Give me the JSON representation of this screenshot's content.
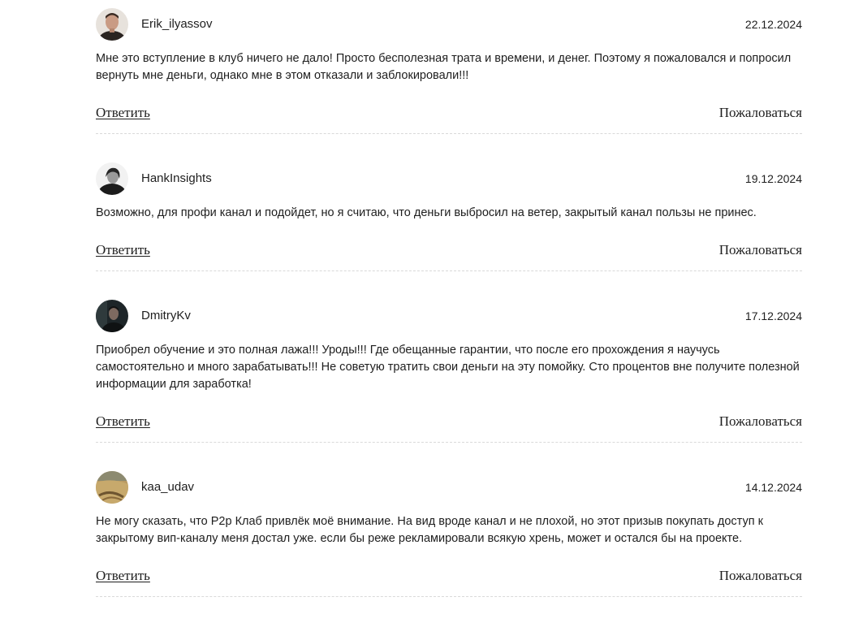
{
  "comments": [
    {
      "username": "Erik_ilyassov",
      "date": "22.12.2024",
      "text": "Мне это вступление в клуб ничего не дало! Просто бесполезная трата и времени, и денег. Поэтому я пожаловался и попросил вернуть мне деньги, однако мне в этом отказали и заблокировали!!!",
      "reply_label": "Ответить",
      "report_label": "Пожаловаться"
    },
    {
      "username": "HankInsights",
      "date": "19.12.2024",
      "text": "Возможно, для профи канал и подойдет, но я считаю, что деньги выбросил на ветер, закрытый канал пользы не принес.",
      "reply_label": "Ответить",
      "report_label": "Пожаловаться"
    },
    {
      "username": "DmitryKv",
      "date": "17.12.2024",
      "text": "Приобрел обучение и это полная лажа!!! Уроды!!! Где обещанные гарантии, что после его прохождения я научусь самостоятельно и много зарабатывать!!! Не советую тратить свои деньги на эту помойку. Сто процентов вне получите полезной информации для заработка!",
      "reply_label": "Ответить",
      "report_label": "Пожаловаться"
    },
    {
      "username": "kaa_udav",
      "date": "14.12.2024",
      "text": "Не могу сказать, что P2p Клаб привлёк моё внимание. На вид вроде канал и не плохой, но этот призыв покупать доступ к закрытому вип-каналу меня достал уже. если бы реже рекламировали всякую хрень, может и остался бы на проекте.",
      "reply_label": "Ответить",
      "report_label": "Пожаловаться"
    }
  ]
}
